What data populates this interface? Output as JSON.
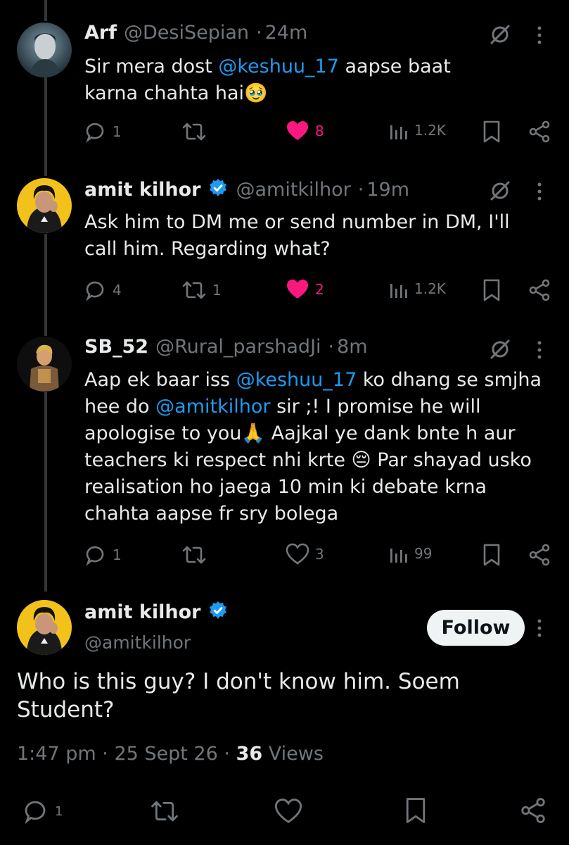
{
  "tweets": [
    {
      "name": "Arf",
      "handle": "@DesiSepian",
      "dot": "·",
      "time": "24m",
      "text_parts": [
        "Sir mera dost ",
        "@keshuu_17",
        " aapse baat karna chahta hai🥹"
      ],
      "replies": "1",
      "retweets": "",
      "likes": "8",
      "liked": true,
      "views": "1.2K"
    },
    {
      "name": "amit kilhor",
      "handle": "@amitkilhor",
      "dot": "·",
      "time": "19m",
      "text": "Ask him to DM me or send number in DM, I'll call him. Regarding what?",
      "replies": "4",
      "retweets": "1",
      "likes": "2",
      "liked": true,
      "views": "1.2K"
    },
    {
      "name": "SB_52",
      "handle": "@Rural_parshadJi",
      "dot": "·",
      "time": "8m",
      "text_parts": [
        "Aap ek baar iss ",
        "@keshuu_17",
        " ko dhang se smjha hee do ",
        "@amitkilhor",
        " sir ;! I promise he will apologise to you🙏 Aajkal ye dank bnte h aur teachers ki respect nhi krte 😔 Par shayad usko realisation ho jaega 10 min ki debate krna chahta aapse fr sry bolega"
      ],
      "replies": "1",
      "retweets": "",
      "likes": "3",
      "liked": false,
      "views": "99"
    }
  ],
  "main": {
    "name": "amit kilhor",
    "handle": "@amitkilhor",
    "follow_label": "Follow",
    "text": "Who is this guy? I don't know him.  Soem Student?",
    "time": "1:47 pm",
    "date": "25 Sept 26",
    "views_count": "36",
    "views_label": "Views",
    "sep": "·",
    "replies": "1"
  },
  "colors": {
    "accent": "#1d9bf0",
    "like": "#f91880",
    "muted": "#71767b",
    "text": "#e7e9ea",
    "background": "#000000"
  },
  "icons": [
    "reply-icon",
    "retweet-icon",
    "heart-icon",
    "views-icon",
    "bookmark-icon",
    "share-icon",
    "grok-icon",
    "more-icon",
    "verified-icon"
  ]
}
